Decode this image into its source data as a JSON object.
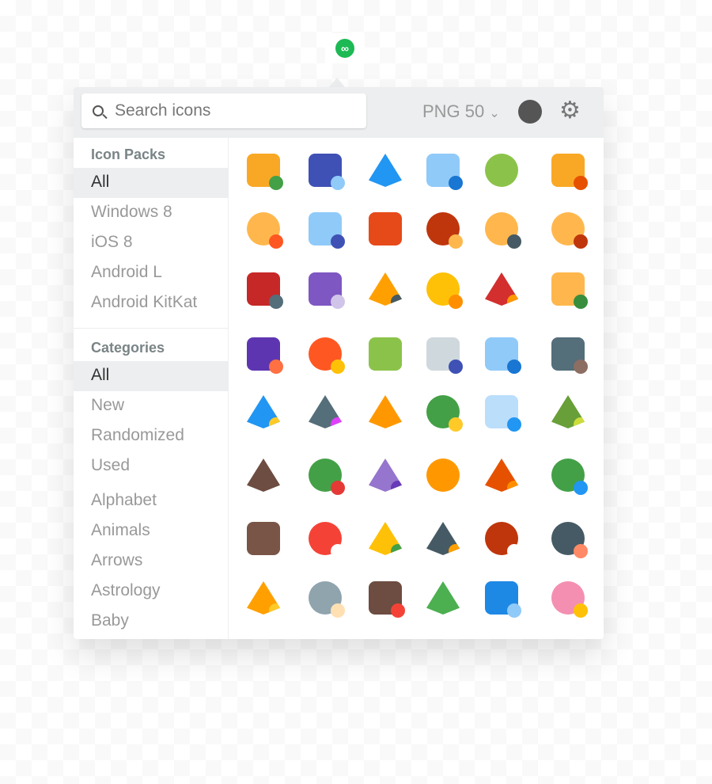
{
  "search": {
    "placeholder": "Search icons"
  },
  "format": "PNG 50",
  "format_chevron": "⌄",
  "gear_glyph": "⚙",
  "logo_glyph": "∞",
  "sidebar": {
    "icon_packs_title": "Icon Packs",
    "icon_packs": [
      {
        "label": "All",
        "active": true
      },
      {
        "label": "Windows 8"
      },
      {
        "label": "iOS 8"
      },
      {
        "label": "Android L"
      },
      {
        "label": "Android KitKat"
      }
    ],
    "categories_title": "Categories",
    "categories": [
      {
        "label": "All",
        "active": true
      },
      {
        "label": "New"
      },
      {
        "label": "Randomized"
      },
      {
        "label": "Used"
      },
      {
        "label": "Alphabet"
      },
      {
        "label": "Animals"
      },
      {
        "label": "Arrows"
      },
      {
        "label": "Astrology"
      },
      {
        "label": "Baby"
      }
    ]
  },
  "icons": [
    {
      "name": "add-ticket",
      "c": "#f9a825",
      "d": "#43a047",
      "shape": "r"
    },
    {
      "name": "megaphone",
      "c": "#3f51b5",
      "d": "#90caf9",
      "shape": "r"
    },
    {
      "name": "airplane",
      "c": "#2196f3",
      "d": "",
      "shape": "p"
    },
    {
      "name": "important-document",
      "c": "#90caf9",
      "d": "#1976d2",
      "shape": "r"
    },
    {
      "name": "approval",
      "c": "#8bc34a",
      "d": "",
      "shape": "c"
    },
    {
      "name": "colosseum",
      "c": "#f9a825",
      "d": "#e65100",
      "shape": "r"
    },
    {
      "name": "customer-support",
      "c": "#ffb74d",
      "d": "#ff5722",
      "shape": "c"
    },
    {
      "name": "astronaut",
      "c": "#90caf9",
      "d": "#3f51b5",
      "shape": "r"
    },
    {
      "name": "briefcase",
      "c": "#e64a19",
      "d": "",
      "shape": "r"
    },
    {
      "name": "bull",
      "c": "#bf360c",
      "d": "#ffb74d",
      "shape": "c"
    },
    {
      "name": "businessman",
      "c": "#ffb74d",
      "d": "#455a64",
      "shape": "c"
    },
    {
      "name": "businesswoman",
      "c": "#ffb74d",
      "d": "#bf360c",
      "shape": "c"
    },
    {
      "name": "car-service",
      "c": "#c62828",
      "d": "#546e7a",
      "shape": "r"
    },
    {
      "name": "cash-register",
      "c": "#7e57c2",
      "d": "#d1c4e9",
      "shape": "r"
    },
    {
      "name": "chainsaw",
      "c": "#ffa000",
      "d": "#455a64",
      "shape": "p"
    },
    {
      "name": "coin",
      "c": "#ffc107",
      "d": "#ff8f00",
      "shape": "c"
    },
    {
      "name": "chili-pepper",
      "c": "#d32f2f",
      "d": "#ff9800",
      "shape": "p"
    },
    {
      "name": "church",
      "c": "#ffb74d",
      "d": "#388e3c",
      "shape": "r"
    },
    {
      "name": "train",
      "c": "#5e35b1",
      "d": "#ff7043",
      "shape": "r"
    },
    {
      "name": "comet",
      "c": "#ff5722",
      "d": "#ffc107",
      "shape": "c"
    },
    {
      "name": "speech-bubble",
      "c": "#8bc34a",
      "d": "",
      "shape": "r"
    },
    {
      "name": "game-controller",
      "c": "#cfd8dc",
      "d": "#3f51b5",
      "shape": "r"
    },
    {
      "name": "office-building",
      "c": "#90caf9",
      "d": "#1976d2",
      "shape": "r"
    },
    {
      "name": "video-camera",
      "c": "#546e7a",
      "d": "#8d6e63",
      "shape": "r"
    },
    {
      "name": "fan",
      "c": "#2196f3",
      "d": "#ffca28",
      "shape": "p"
    },
    {
      "name": "magic-wand",
      "c": "#546e7a",
      "d": "#e040fb",
      "shape": "p"
    },
    {
      "name": "filter",
      "c": "#ff9800",
      "d": "",
      "shape": "p"
    },
    {
      "name": "hat",
      "c": "#43a047",
      "d": "#ffca28",
      "shape": "c"
    },
    {
      "name": "keyboard",
      "c": "#bbdefb",
      "d": "#2196f3",
      "shape": "r"
    },
    {
      "name": "palm-leaf",
      "c": "#689f38",
      "d": "#cddc39",
      "shape": "p"
    },
    {
      "name": "mustache",
      "c": "#6d4c41",
      "d": "",
      "shape": "p"
    },
    {
      "name": "ninja-turtle",
      "c": "#43a047",
      "d": "#e53935",
      "shape": "c"
    },
    {
      "name": "origami",
      "c": "#9575cd",
      "d": "#673ab7",
      "shape": "p"
    },
    {
      "name": "pretzel",
      "c": "#ff9800",
      "d": "",
      "shape": "c"
    },
    {
      "name": "pyramids",
      "c": "#e65100",
      "d": "#ff8f00",
      "shape": "p"
    },
    {
      "name": "umbrella",
      "c": "#43a047",
      "d": "#2196f3",
      "shape": "c"
    },
    {
      "name": "sagrada-familia",
      "c": "#795548",
      "d": "",
      "shape": "r"
    },
    {
      "name": "power-button",
      "c": "#f44336",
      "d": "#fff",
      "shape": "c"
    },
    {
      "name": "sombrero",
      "c": "#ffc107",
      "d": "#43a047",
      "shape": "p"
    },
    {
      "name": "shovel",
      "c": "#455a64",
      "d": "#ffa000",
      "shape": "p"
    },
    {
      "name": "football",
      "c": "#bf360c",
      "d": "#fff",
      "shape": "c"
    },
    {
      "name": "sushi",
      "c": "#455a64",
      "d": "#ff8a65",
      "shape": "c"
    },
    {
      "name": "highlighter",
      "c": "#ffa000",
      "d": "#ffca28",
      "shape": "p"
    },
    {
      "name": "viking-helmet",
      "c": "#90a4ae",
      "d": "#ffe0b2",
      "shape": "c"
    },
    {
      "name": "viking-ship",
      "c": "#6d4c41",
      "d": "#f44336",
      "shape": "r"
    },
    {
      "name": "cactus",
      "c": "#4caf50",
      "d": "",
      "shape": "p"
    },
    {
      "name": "pos-terminal",
      "c": "#1e88e5",
      "d": "#90caf9",
      "shape": "r"
    },
    {
      "name": "piggy-bank",
      "c": "#f48fb1",
      "d": "#ffc107",
      "shape": "c"
    }
  ]
}
